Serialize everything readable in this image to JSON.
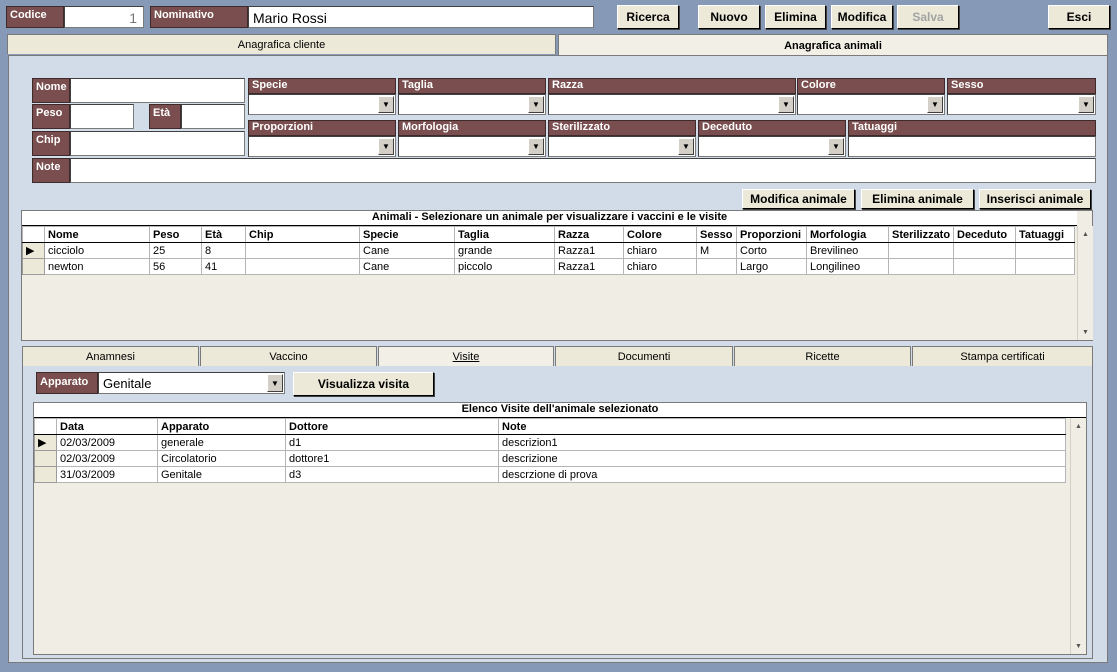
{
  "header": {
    "codice_label": "Codice",
    "codice_value": "1",
    "nominativo_label": "Nominativo",
    "nominativo_value": "Mario Rossi",
    "buttons": {
      "ricerca": "Ricerca",
      "nuovo": "Nuovo",
      "elimina": "Elimina",
      "modifica": "Modifica",
      "salva": "Salva",
      "esci": "Esci"
    }
  },
  "main_tabs": {
    "cliente": "Anagrafica cliente",
    "animali": "Anagrafica animali"
  },
  "form": {
    "nome": "Nome",
    "peso": "Peso",
    "eta": "Età",
    "chip": "Chip",
    "note": "Note",
    "specie": "Specie",
    "taglia": "Taglia",
    "razza": "Razza",
    "colore": "Colore",
    "sesso": "Sesso",
    "proporzioni": "Proporzioni",
    "morfologia": "Morfologia",
    "sterilizzato": "Sterilizzato",
    "deceduto": "Deceduto",
    "tatuaggi": "Tatuaggi"
  },
  "animal_buttons": {
    "modifica": "Modifica animale",
    "elimina": "Elimina animale",
    "inserisci": "Inserisci animale"
  },
  "animals_grid": {
    "caption": "Animali - Selezionare un animale per visualizzare i vaccini e le visite",
    "columns": [
      "Nome",
      "Peso",
      "Età",
      "Chip",
      "Specie",
      "Taglia",
      "Razza",
      "Colore",
      "Sesso",
      "Proporzioni",
      "Morfologia",
      "Sterilizzato",
      "Deceduto",
      "Tatuaggi"
    ],
    "rows": [
      [
        "cicciolo",
        "25",
        "8",
        "",
        "Cane",
        "grande",
        "Razza1",
        "chiaro",
        "M",
        "Corto",
        "Brevilineo",
        "",
        "",
        ""
      ],
      [
        "newton",
        "56",
        "41",
        "",
        "Cane",
        "piccolo",
        "Razza1",
        "chiaro",
        "",
        "Largo",
        "Longilineo",
        "",
        "",
        ""
      ]
    ]
  },
  "sub_tabs": [
    "Anamnesi",
    "Vaccino",
    "Visite",
    "Documenti",
    "Ricette",
    "Stampa certificati"
  ],
  "visite": {
    "apparato_label": "Apparato",
    "apparato_value": "Genitale",
    "visualizza_button": "Visualizza visita",
    "caption": "Elenco Visite dell'animale selezionato",
    "columns": [
      "Data",
      "Apparato",
      "Dottore",
      "Note"
    ],
    "rows": [
      [
        "02/03/2009",
        "generale",
        "d1",
        "descrizion1"
      ],
      [
        "02/03/2009",
        "Circolatorio",
        "dottore1",
        "descrizione"
      ],
      [
        "31/03/2009",
        "Genitale",
        "d3",
        "descrzione di prova"
      ]
    ]
  }
}
